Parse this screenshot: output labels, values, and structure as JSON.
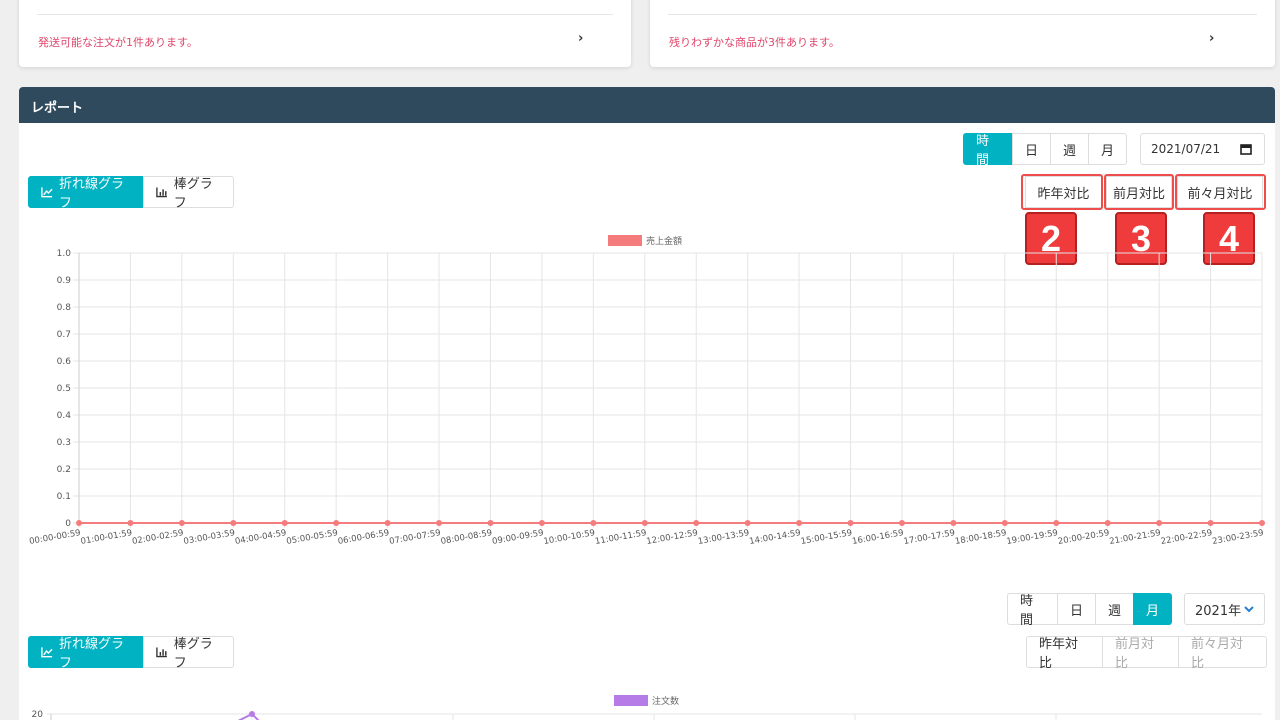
{
  "notices": {
    "left_message": "発送可能な注文が1件あります。",
    "right_message": "残りわずかな商品が3件あります。",
    "chevron": "›"
  },
  "report": {
    "title": "レポート",
    "chart1": {
      "period_tabs": [
        "時間",
        "日",
        "週",
        "月"
      ],
      "active_period": "時間",
      "date_value": "2021/07/21",
      "view_tabs": [
        "折れ線グラフ",
        "棒グラフ"
      ],
      "active_view": "折れ線グラフ",
      "compare_buttons": [
        "昨年対比",
        "前月対比",
        "前々月対比"
      ],
      "annotations": [
        "2",
        "3",
        "4"
      ]
    },
    "chart2": {
      "period_tabs": [
        "時間",
        "日",
        "週",
        "月"
      ],
      "active_period": "月",
      "year_value": "2021年",
      "view_tabs": [
        "折れ線グラフ",
        "棒グラフ"
      ],
      "active_view": "折れ線グラフ",
      "compare_buttons": [
        "昨年対比",
        "前月対比",
        "前々月対比"
      ]
    }
  },
  "colors": {
    "accent": "#00b2c2",
    "header": "#2e4a5c",
    "notice_text": "#e0466b",
    "series1": "#f47c7c",
    "series2": "#b57ce8"
  },
  "chart_data": [
    {
      "type": "line",
      "legend": [
        "売上金額"
      ],
      "categories": [
        "00:00-00:59",
        "01:00-01:59",
        "02:00-02:59",
        "03:00-03:59",
        "04:00-04:59",
        "05:00-05:59",
        "06:00-06:59",
        "07:00-07:59",
        "08:00-08:59",
        "09:00-09:59",
        "10:00-10:59",
        "11:00-11:59",
        "12:00-12:59",
        "13:00-13:59",
        "14:00-14:59",
        "15:00-15:59",
        "16:00-16:59",
        "17:00-17:59",
        "18:00-18:59",
        "19:00-19:59",
        "20:00-20:59",
        "21:00-21:59",
        "22:00-22:59",
        "23:00-23:59"
      ],
      "series": [
        {
          "name": "売上金額",
          "values": [
            0,
            0,
            0,
            0,
            0,
            0,
            0,
            0,
            0,
            0,
            0,
            0,
            0,
            0,
            0,
            0,
            0,
            0,
            0,
            0,
            0,
            0,
            0,
            0
          ]
        }
      ],
      "y_ticks": [
        "0",
        "0.1",
        "0.2",
        "0.3",
        "0.4",
        "0.5",
        "0.6",
        "0.7",
        "0.8",
        "0.9",
        "1.0"
      ],
      "ylim": [
        0,
        1
      ],
      "grid": true,
      "legend_position": "top"
    },
    {
      "type": "line",
      "legend": [
        "注文数"
      ],
      "series": [
        {
          "name": "注文数",
          "values": [
            20
          ]
        }
      ],
      "y_ticks": [
        "20"
      ],
      "grid": true,
      "legend_position": "top"
    }
  ]
}
